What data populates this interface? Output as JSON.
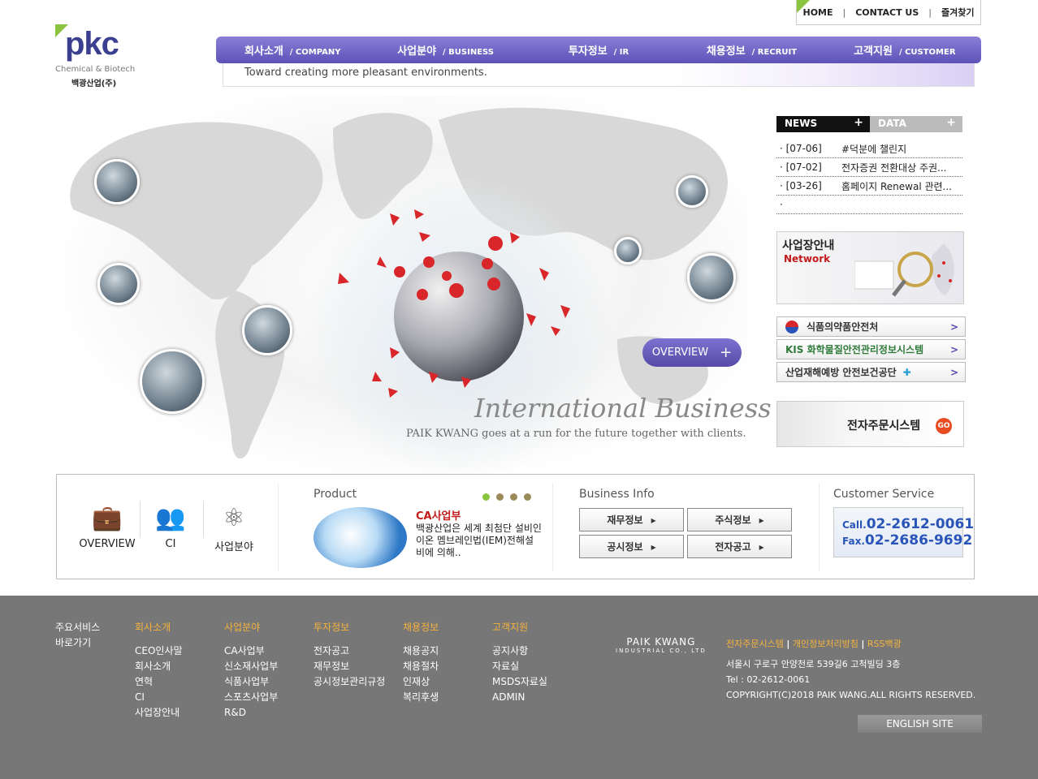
{
  "util": {
    "home": "HOME",
    "contact": "CONTACT US",
    "favorite": "즐겨찾기",
    "sep": "|"
  },
  "logo": {
    "word": "pkc",
    "sub": "Chemical & Biotech",
    "kr": "백광산업(주)"
  },
  "nav": [
    {
      "kr": "회사소개",
      "en": "/ COMPANY"
    },
    {
      "kr": "사업분야",
      "en": "/ BUSINESS"
    },
    {
      "kr": "투자정보",
      "en": "/ IR"
    },
    {
      "kr": "채용정보",
      "en": "/ RECRUIT"
    },
    {
      "kr": "고객지원",
      "en": "/ CUSTOMER"
    }
  ],
  "slogan": "Toward creating more pleasant environments.",
  "hero": {
    "overview": "OVERVIEW",
    "plus": "+",
    "title": "International Business",
    "sub": "PAIK KWANG goes at a run for the future together with clients."
  },
  "tabs": {
    "news": "NEWS",
    "data": "DATA",
    "plus": "+"
  },
  "news": [
    {
      "date": "· [07-06]",
      "title": "#덕분에 챌린지"
    },
    {
      "date": "· [07-02]",
      "title": "전자증권 전환대상 주권..."
    },
    {
      "date": "· [03-26]",
      "title": "홈페이지 Renewal 관련..."
    },
    {
      "date": "·",
      "title": ""
    }
  ],
  "network": {
    "title": "사업장안내",
    "sub": "Network"
  },
  "links": [
    {
      "label": "식품의약품안전처",
      "arrow": ">"
    },
    {
      "label": "KIS 화학물질안전관리정보시스템",
      "arrow": ">"
    },
    {
      "label": "산업재해예방 안전보건공단",
      "arrow": ">"
    }
  ],
  "eorder": {
    "label": "전자주문시스템",
    "go": "GO"
  },
  "quick": {
    "overview": "OVERVIEW",
    "ci": "CI",
    "biz": "사업분야"
  },
  "product": {
    "title": "Product",
    "name": "CA사업부",
    "desc": "백광산업은 세계 최첨단 설비인 이온 멤브레인법(IEM)전해설비에 의해.."
  },
  "business": {
    "title": "Business Info",
    "b1": "재무정보",
    "b2": "주식정보",
    "b3": "공시정보",
    "b4": "전자공고",
    "arrow": "▸"
  },
  "customer": {
    "title": "Customer Service",
    "call_label": "Call.",
    "call": "02-2612-0061",
    "fax_label": "Fax.",
    "fax": "02-2686-9692"
  },
  "footer": {
    "main": [
      "주요서비스",
      "바로가기"
    ],
    "cols": [
      {
        "h": "회사소개",
        "items": [
          "CEO인사말",
          "회사소개",
          "연혁",
          "CI",
          "사업장안내"
        ]
      },
      {
        "h": "사업분야",
        "items": [
          "CA사업부",
          "신소재사업부",
          "식품사업부",
          "스포츠사업부",
          "R&D"
        ]
      },
      {
        "h": "투자정보",
        "items": [
          "전자공고",
          "재무정보",
          "공시정보관리규정"
        ]
      },
      {
        "h": "채용정보",
        "items": [
          "채용공지",
          "채용절차",
          "인재상",
          "복리후생"
        ]
      },
      {
        "h": "고객지원",
        "items": [
          "공지사항",
          "자료실",
          "MSDS자료실",
          "ADMIN"
        ]
      }
    ],
    "brand": "PAIK KWANG",
    "brand_sub": "INDUSTRIAL CO., LTD",
    "l1": "전자주문시스템",
    "l2": "개인정보처리방침",
    "l3": "RSS백광",
    "sep": "|",
    "addr": "서울시 구로구 안양천로 539길6 고척빌딩 3층",
    "tel": "Tel : 02-2612-0061",
    "copy": "COPYRIGHT(C)2018 PAIK WANG.ALL RIGHTS RESERVED.",
    "english": "ENGLISH SITE"
  }
}
